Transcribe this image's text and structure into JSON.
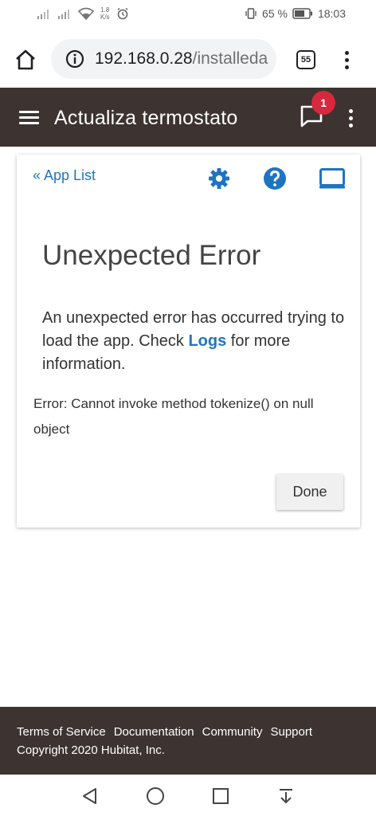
{
  "status_bar": {
    "speed_value": "1.8",
    "speed_unit": "K/s",
    "battery_text": "65 %",
    "time": "18:03"
  },
  "browser": {
    "url_host": "192.168.0.28",
    "url_path": "/installeda",
    "tab_count": "55"
  },
  "header": {
    "title": "Actualiza termostato",
    "notification_count": "1"
  },
  "card": {
    "app_list_link": "« App List",
    "error_title": "Unexpected Error",
    "message_before": "An unexpected error has occurred trying to load the app. Check ",
    "message_link": "Logs",
    "message_after": " for more information.",
    "error_detail": "Error: Cannot invoke method tokenize() on null object",
    "done_label": "Done"
  },
  "footer": {
    "links": [
      "Terms of Service",
      "Documentation",
      "Community",
      "Support"
    ],
    "copyright": "Copyright 2020 Hubitat, Inc."
  },
  "colors": {
    "header_bg": "#3d3330",
    "link_blue": "#1f74c0",
    "badge_red": "#d8283d"
  },
  "icons": [
    "signal-icon",
    "wifi-icon",
    "alarm-icon",
    "vibrate-icon",
    "battery-icon",
    "home-icon",
    "info-icon",
    "menu-icon",
    "chat-icon",
    "gear-icon",
    "help-icon",
    "monitor-icon",
    "back-icon",
    "home-circle-icon",
    "recents-icon",
    "download-icon"
  ]
}
